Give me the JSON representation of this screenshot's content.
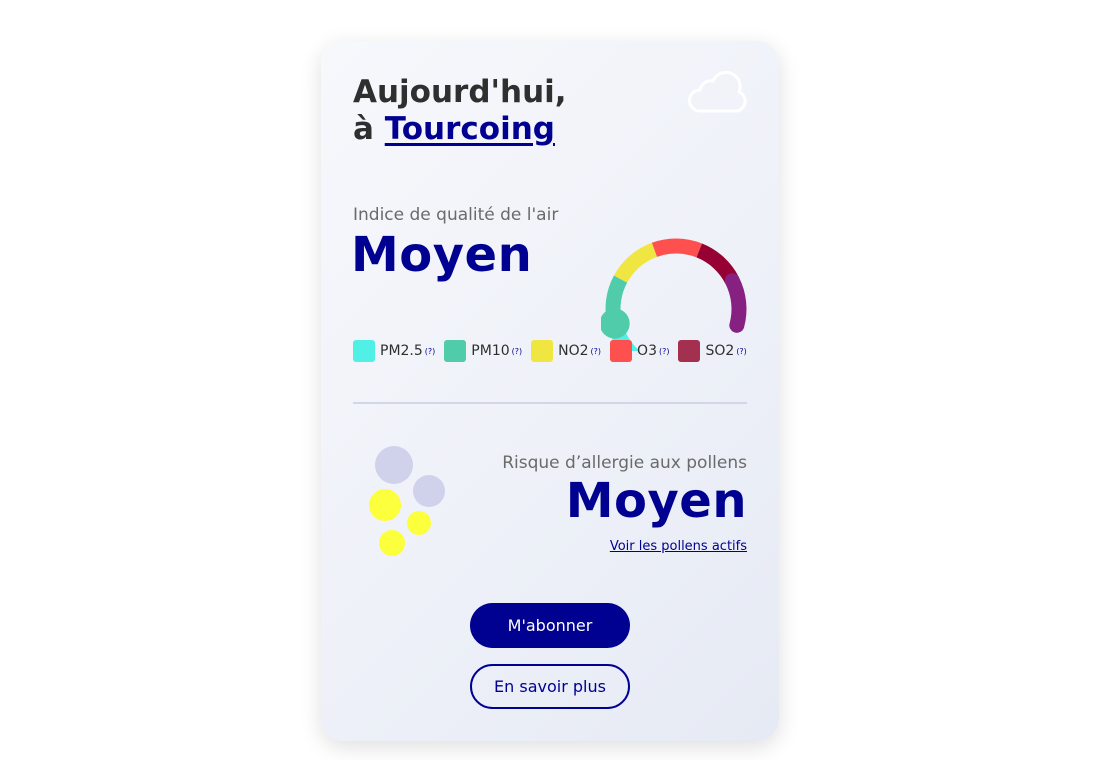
{
  "header": {
    "title_line1": "Aujourd'hui,",
    "title_prefix": "à",
    "city": "Tourcoing",
    "weather_icon": "cloud-icon"
  },
  "air_quality": {
    "label": "Indice de qualité de l'air",
    "value": "Moyen",
    "gauge_level": 2,
    "gauge_levels_total": 6,
    "gauge_colors": [
      "#50f0e6",
      "#50ccaa",
      "#f0e641",
      "#ff5050",
      "#960032",
      "#872181"
    ]
  },
  "pollutants": [
    {
      "name": "PM2.5",
      "note": "(?)",
      "color": "#50f0e6"
    },
    {
      "name": "PM10",
      "note": "(?)",
      "color": "#50ccaa"
    },
    {
      "name": "NO2",
      "note": "(?)",
      "color": "#f0e641"
    },
    {
      "name": "O3",
      "note": "(?)",
      "color": "#ff5050"
    },
    {
      "name": "SO2",
      "note": "(?)",
      "color": "#a3304f"
    }
  ],
  "pollen": {
    "label": "Risque d’allergie aux pollens",
    "value": "Moyen",
    "link": "Voir les pollens actifs",
    "circle_colors": [
      "#cfd2ea",
      "#fcff3c"
    ]
  },
  "buttons": {
    "subscribe": "M'abonner",
    "learn_more": "En savoir plus"
  }
}
